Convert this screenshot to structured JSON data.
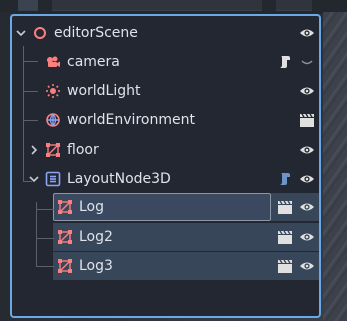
{
  "scene_tree": {
    "nodes": [
      {
        "label": "editorScene",
        "icon": "node-3d-root-icon"
      },
      {
        "label": "camera",
        "icon": "camera-icon",
        "right_icon": "script-icon"
      },
      {
        "label": "worldLight",
        "icon": "sun-light-icon"
      },
      {
        "label": "worldEnvironment",
        "icon": "world-environment-icon",
        "right_icon": "clapperboard-icon"
      },
      {
        "label": "floor",
        "icon": "mesh-instance-icon"
      },
      {
        "label": "LayoutNode3D",
        "icon": "layout-node-icon",
        "right_icon": "script-icon"
      },
      {
        "label": "Log",
        "icon": "mesh-instance-icon",
        "right_icon": "clapperboard-icon",
        "selected": true
      },
      {
        "label": "Log2",
        "icon": "mesh-instance-icon",
        "right_icon": "clapperboard-icon",
        "selected": true
      },
      {
        "label": "Log3",
        "icon": "mesh-instance-icon",
        "right_icon": "clapperboard-icon",
        "selected": true
      }
    ]
  },
  "colors": {
    "panel_bg": "#232731",
    "focus_border": "#6aa9e6",
    "selection_bg": "#38465a",
    "text": "#dfe3ea",
    "node_red": "#fc7f7f",
    "node_blue": "#8da5f3"
  }
}
